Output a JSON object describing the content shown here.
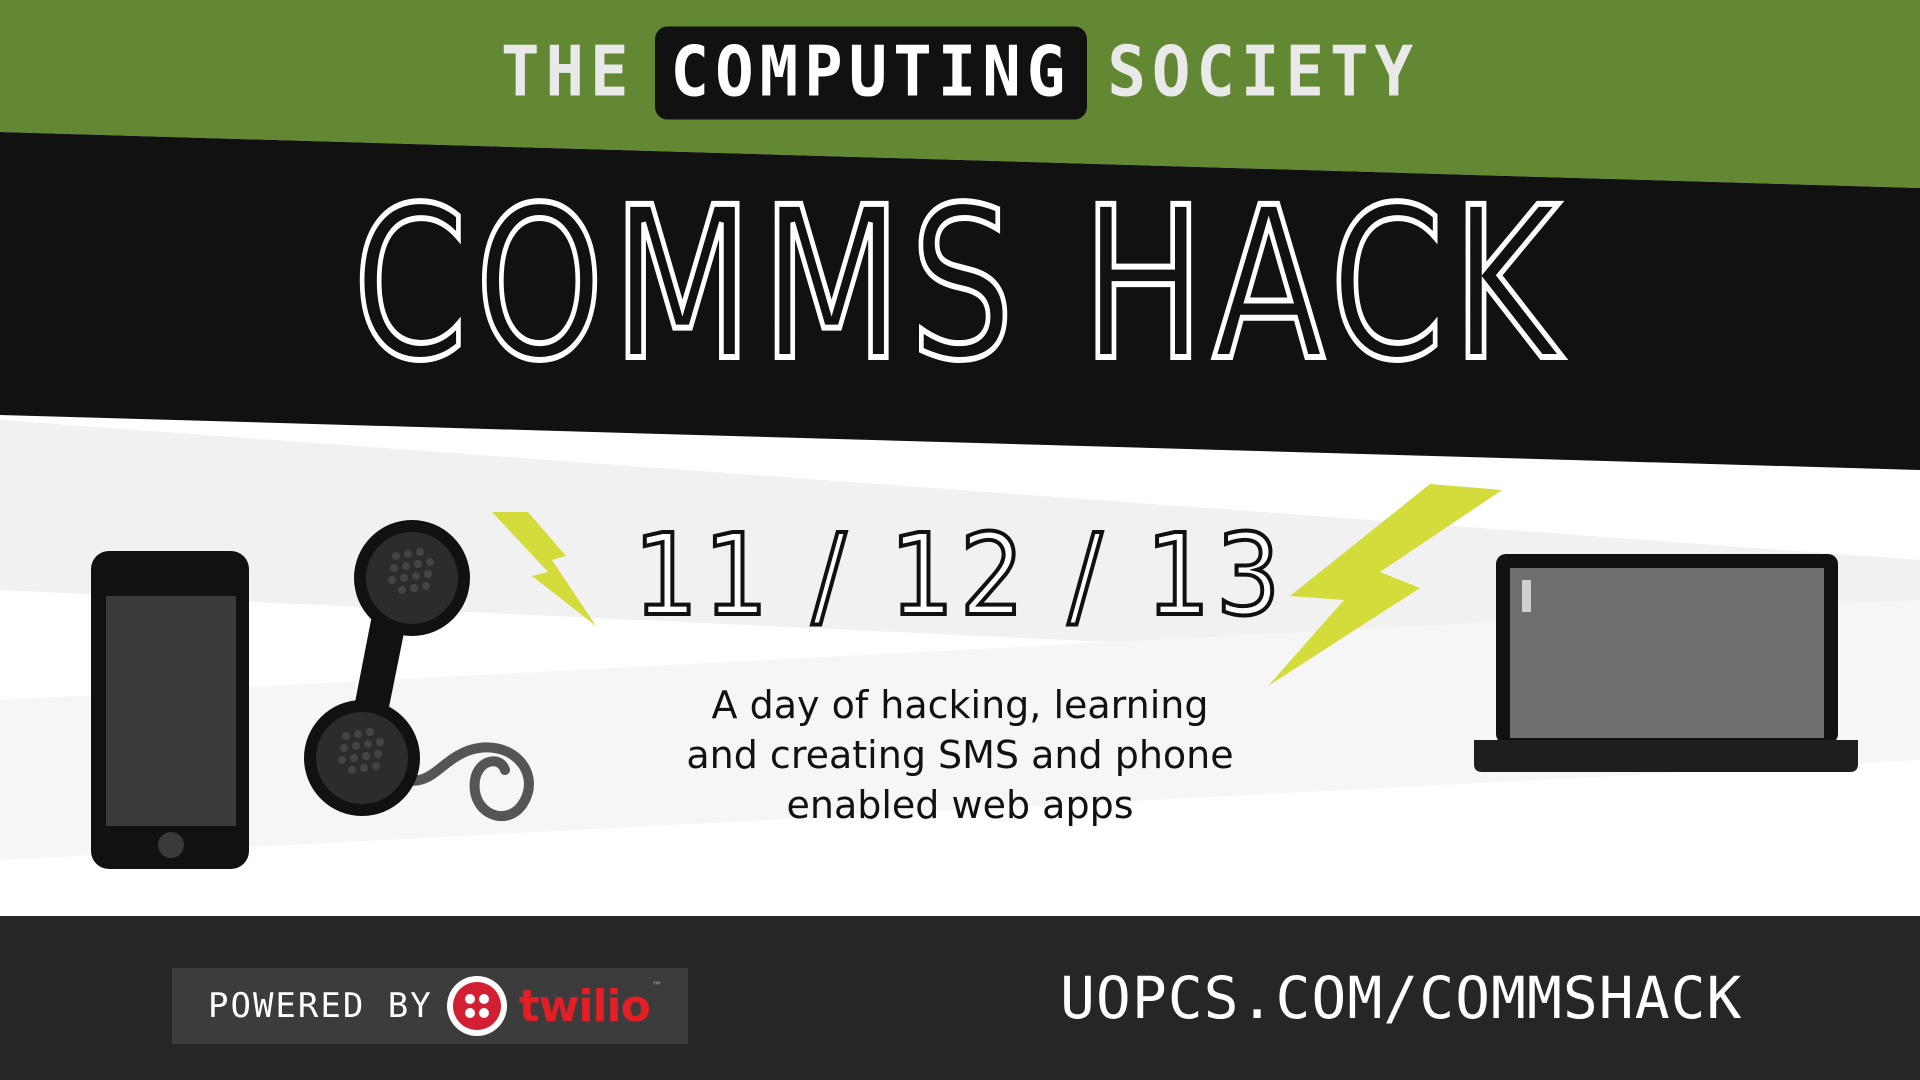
{
  "header": {
    "pre": "THE",
    "highlight": "COMPUTING",
    "post": "SOCIETY"
  },
  "event": {
    "title": "COMMS HACK",
    "date": "11 / 12 / 13",
    "tagline": [
      "A day of hacking, learning",
      "and creating SMS and phone",
      "enabled web apps"
    ]
  },
  "footer": {
    "powered_by": "POWERED BY",
    "sponsor": "twilio",
    "sponsor_mark": "™",
    "url": "UOPCS.COM/COMMSHACK"
  },
  "colors": {
    "green": "#628834",
    "black": "#111111",
    "footer": "#262626",
    "bolt": "#d4dc3c",
    "twilio_red": "#e31e25"
  },
  "icons": [
    "smartphone-icon",
    "telephone-handset-icon",
    "lightning-bolt-icon",
    "laptop-icon",
    "twilio-logo-icon"
  ]
}
